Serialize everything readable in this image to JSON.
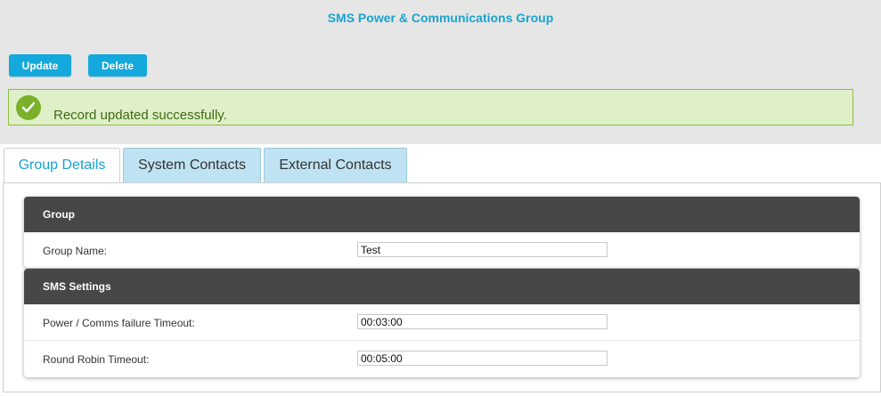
{
  "header": {
    "title": "SMS Power & Communications Group"
  },
  "toolbar": {
    "update_label": "Update",
    "delete_label": "Delete"
  },
  "alert": {
    "message": "Record updated successfully.",
    "icon": "check-circle-icon",
    "color": "#7ab02a"
  },
  "tabs": [
    {
      "label": "Group Details",
      "active": true
    },
    {
      "label": "System Contacts",
      "active": false
    },
    {
      "label": "External Contacts",
      "active": false
    }
  ],
  "sections": {
    "group": {
      "title": "Group",
      "fields": [
        {
          "label": "Group Name:",
          "value": "Test"
        }
      ]
    },
    "sms": {
      "title": "SMS Settings",
      "fields": [
        {
          "label": "Power / Comms failure Timeout:",
          "value": "00:03:00"
        },
        {
          "label": "Round Robin Timeout:",
          "value": "00:05:00"
        }
      ]
    }
  },
  "colors": {
    "accent": "#14a9dc",
    "header_bg": "#474747",
    "alert_bg": "#dff0c8"
  }
}
